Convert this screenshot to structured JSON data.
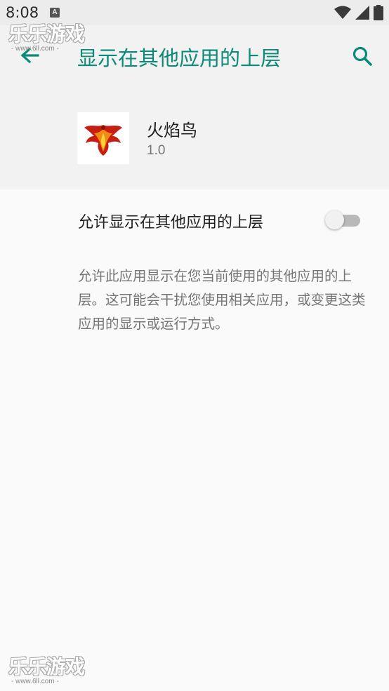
{
  "status_bar": {
    "time": "8:08",
    "notification_glyph": "A"
  },
  "app_bar": {
    "title": "显示在其他应用的上层",
    "accent_color": "#0a8a78"
  },
  "app_info": {
    "name": "火焰鸟",
    "version": "1.0"
  },
  "permission": {
    "label": "允许显示在其他应用的上层",
    "enabled": false,
    "description": "允许此应用显示在您当前使用的其他应用的上层。这可能会干扰您使用相关应用，或变更这类应用的显示或运行方式。"
  },
  "watermark": {
    "text": "乐乐游戏",
    "url": "- www.6ll.com -"
  }
}
